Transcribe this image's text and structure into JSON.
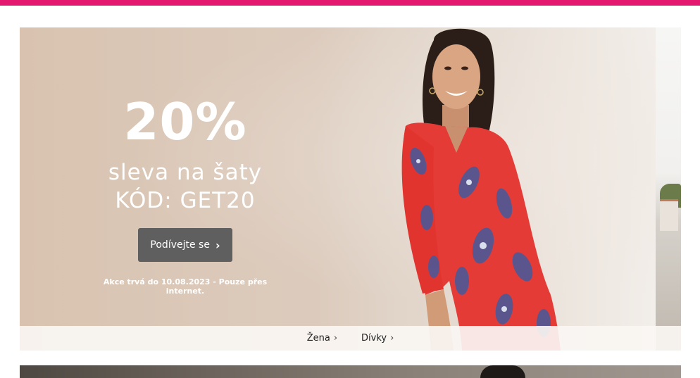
{
  "colors": {
    "brand": "#e4186e",
    "cta_bg": "#5f5f5f",
    "dress": "#e43b37"
  },
  "hero": {
    "discount": "20%",
    "subtitle": "sleva na šaty",
    "code": "KÓD: GET20",
    "cta_label": "Podívejte se",
    "cta_icon": "chevron-right-icon",
    "note": "Akce trvá do 10.08.2023 - Pouze přes internet.",
    "image": "woman-in-red-paisley-dress"
  },
  "subnav": {
    "items": [
      {
        "label": "Žena",
        "icon": "chevron-right-icon"
      },
      {
        "label": "Dívky",
        "icon": "chevron-right-icon"
      }
    ]
  }
}
